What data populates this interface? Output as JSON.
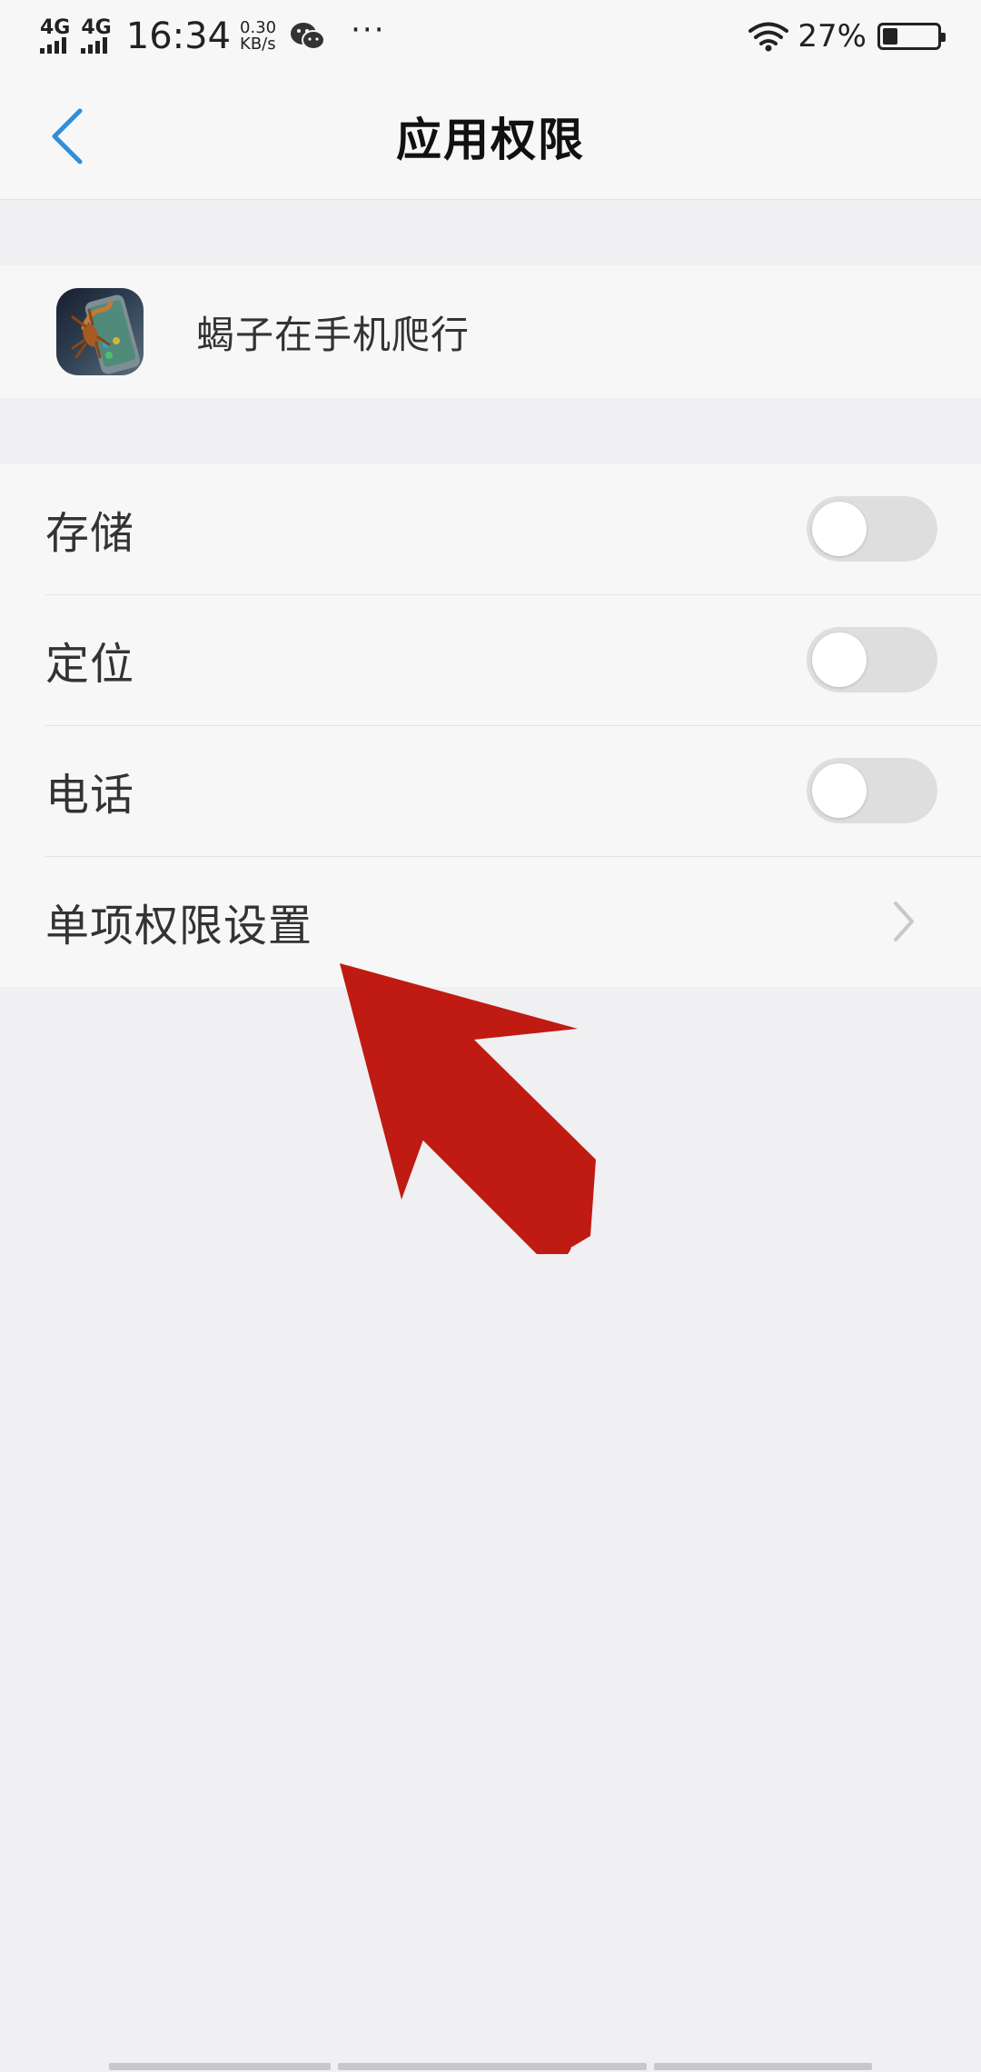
{
  "status_bar": {
    "signal1_label": "4G",
    "signal2_label": "4G",
    "time": "16:34",
    "net_speed_value": "0.30",
    "net_speed_unit": "KB/s",
    "more_dots": "···",
    "battery_percent": "27%",
    "battery_level": 0.27
  },
  "nav": {
    "title": "应用权限",
    "back_icon": "chevron-left-icon"
  },
  "app": {
    "name": "蝎子在手机爬行",
    "icon": "scorpion-app-icon"
  },
  "permissions": [
    {
      "label": "存储",
      "enabled": false
    },
    {
      "label": "定位",
      "enabled": false
    },
    {
      "label": "电话",
      "enabled": false
    }
  ],
  "single_permission_settings": {
    "label": "单项权限设置",
    "icon": "chevron-right-icon"
  },
  "colors": {
    "accent": "#2f8fd8",
    "arrow": "#bf1b12",
    "toggle_off": "#dedede"
  }
}
